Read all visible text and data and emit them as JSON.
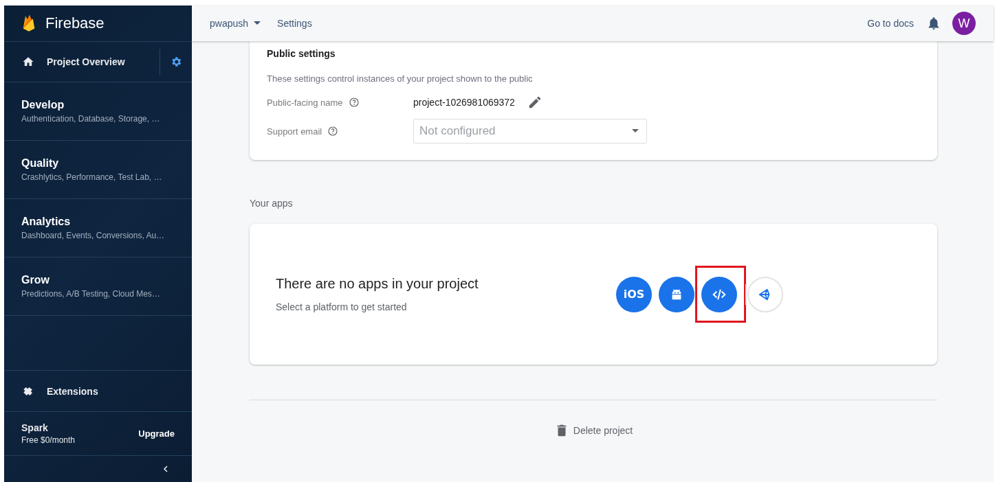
{
  "sidebar": {
    "brand": "Firebase",
    "overview": {
      "label": "Project Overview"
    },
    "sections": [
      {
        "title": "Develop",
        "subtitle": "Authentication, Database, Storage, …"
      },
      {
        "title": "Quality",
        "subtitle": "Crashlytics, Performance, Test Lab, …"
      },
      {
        "title": "Analytics",
        "subtitle": "Dashboard, Events, Conversions, Au…"
      },
      {
        "title": "Grow",
        "subtitle": "Predictions, A/B Testing, Cloud Mes…"
      }
    ],
    "extensions": {
      "label": "Extensions"
    },
    "plan": {
      "name": "Spark",
      "price": "Free $0/month",
      "action": "Upgrade"
    }
  },
  "header": {
    "project": "pwapush",
    "page": "Settings",
    "docs": "Go to docs",
    "avatar": "W"
  },
  "public_settings": {
    "title": "Public settings",
    "description": "These settings control instances of your project shown to the public",
    "fields": [
      {
        "kind": "text",
        "label": "Public-facing name",
        "value": "project-1026981069372"
      },
      {
        "kind": "select",
        "label": "Support email",
        "placeholder": "Not configured"
      }
    ]
  },
  "apps": {
    "title": "Your apps",
    "empty_title": "There are no apps in your project",
    "empty_subtitle": "Select a platform to get started",
    "platforms": [
      {
        "kind": "ios",
        "label": "iOS",
        "highlighted": false
      },
      {
        "kind": "android",
        "highlighted": false
      },
      {
        "kind": "web",
        "highlighted": true
      },
      {
        "kind": "unity",
        "highlighted": false
      }
    ]
  },
  "delete": {
    "label": "Delete project"
  }
}
